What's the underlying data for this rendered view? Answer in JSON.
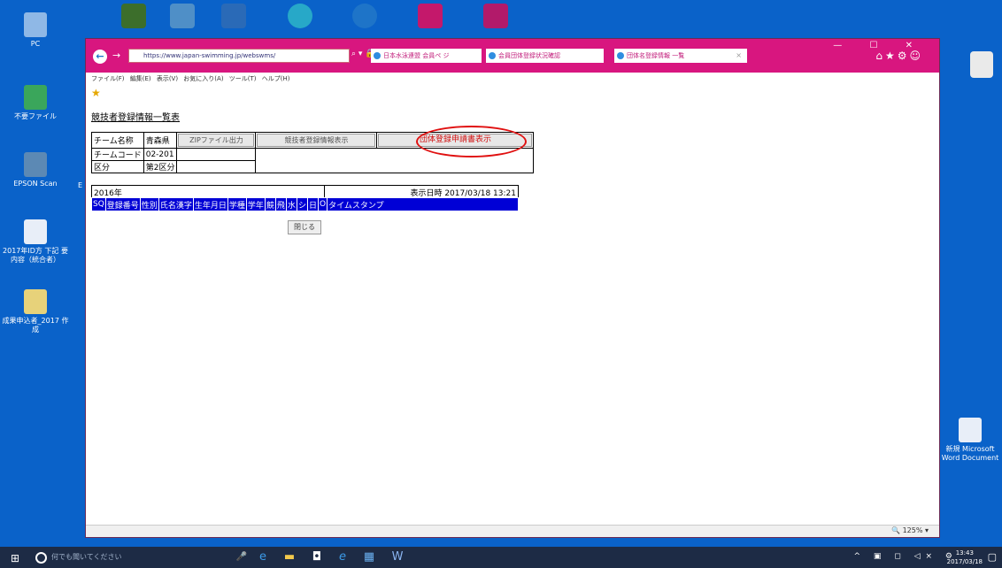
{
  "desktop": {
    "icons_left": [
      {
        "label": "PC"
      },
      {
        "label": "不要ファイル"
      },
      {
        "label": "EPSON Scan"
      },
      {
        "label": "2017年ID方 下記 要内容（統合者）"
      },
      {
        "label": "成果申込者_2017 作成"
      }
    ],
    "icon_right": {
      "label": "新規 Microsoft Word Document"
    },
    "stray_label": "E"
  },
  "browser": {
    "window_controls": "— ☐ ✕",
    "address": "https://www.japan-swimming.jp/webswms/",
    "tabs": [
      {
        "label": "日本水泳連盟 会員ペ ジ"
      },
      {
        "label": "会員団体登録状況確認"
      },
      {
        "label": "団体名登録情報 一覧"
      }
    ],
    "tab_close": "×",
    "menu": "ファイル(F)  編集(E)  表示(V)  お気に入り(A)  ツール(T)  ヘルプ(H)",
    "zoom": "🔍 125%  ▾",
    "favorite_star": "★"
  },
  "page": {
    "title": "競技者登録情報一覧表",
    "team_name_label": "チーム名称",
    "team_name_value": "青森県",
    "team_code_label": "チームコード",
    "team_code_value": "02-201",
    "division_label": "区分",
    "division_value": "第2区分",
    "buttons": {
      "zip": "ZIPファイル出力",
      "list": "競技者登録情報表示",
      "apply": "団体登録申請書表示",
      "close": "閉じる"
    },
    "year": "2016年",
    "display_date_label": "表示日時",
    "display_date_value": "2017/03/18 13:21",
    "columns": [
      "SQ",
      "登録番号",
      "性別",
      "氏名漢字",
      "生年月日",
      "学種",
      "学年",
      "競",
      "飛",
      "水",
      "シ",
      "日",
      "O",
      "タイムスタンプ"
    ]
  },
  "taskbar": {
    "search_placeholder": "何でも聞いてください",
    "tray": "^ ▣ ◻ ◁× ⚙",
    "time": "13:43",
    "date": "2017/03/18"
  }
}
